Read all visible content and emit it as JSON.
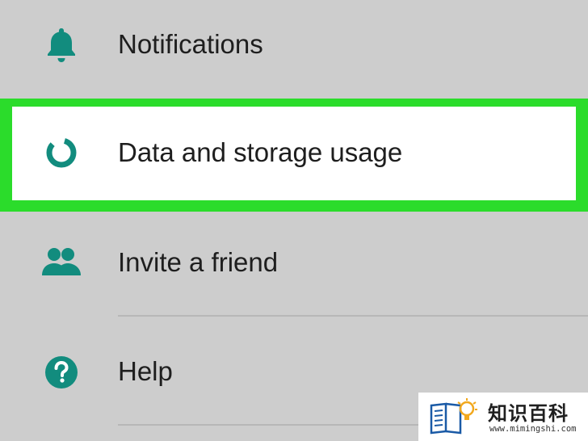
{
  "menu": {
    "items": [
      {
        "label": "Notifications",
        "icon": "bell-icon"
      },
      {
        "label": "Data and storage usage",
        "icon": "data-usage-ring-icon",
        "highlighted": true
      },
      {
        "label": "Invite a friend",
        "icon": "people-icon"
      },
      {
        "label": "Help",
        "icon": "help-circle-icon"
      }
    ]
  },
  "colors": {
    "background": "#cdcdcd",
    "icon": "#128c7e",
    "highlight_border": "#2bdc2b",
    "highlight_fill": "#ffffff",
    "text": "#1e1e1e",
    "divider": "#b7b7b7"
  },
  "watermark": {
    "title": "知识百科",
    "url": "www.mimingshi.com"
  }
}
